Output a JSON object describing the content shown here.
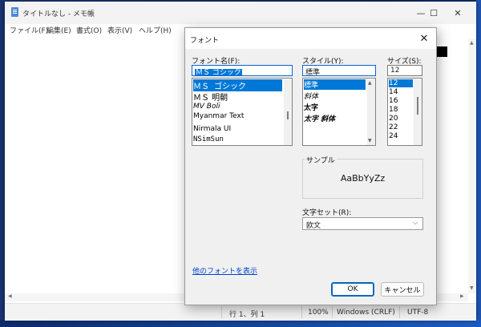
{
  "window": {
    "title": "タイトルなし - メモ帳",
    "minimize_glyph": "—",
    "maximize_glyph": "☐",
    "close_glyph": "✕"
  },
  "menu": [
    "ファイル(F)",
    "編集(E)",
    "書式(O)",
    "表示(V)",
    "ヘルプ(H)"
  ],
  "statusbar": {
    "position": "行 1、列 1",
    "zoom": "100%",
    "line_ending": "Windows (CRLF)",
    "encoding": "UTF-8"
  },
  "dialog": {
    "title": "フォント",
    "close_glyph": "✕",
    "font_name": {
      "label": "フォント名(F):",
      "value": "ＭＳ ゴシック",
      "items": [
        "ＭＳ ゴシック",
        "ＭＳ 明朝",
        "MV Boli",
        "Myanmar Text",
        "Nirmala UI",
        "NSimSun"
      ],
      "selected_index": 0
    },
    "style": {
      "label": "スタイル(Y):",
      "value": "標準",
      "items": [
        "標準",
        "斜体",
        "太字",
        "太字 斜体"
      ],
      "selected_index": 0
    },
    "size": {
      "label": "サイズ(S):",
      "value": "12",
      "items": [
        "12",
        "14",
        "16",
        "18",
        "20",
        "22",
        "24"
      ],
      "selected_index": 0
    },
    "sample": {
      "label": "サンプル",
      "text": "AaBbYyZz"
    },
    "charset": {
      "label": "文字セット(R):",
      "value": "欧文"
    },
    "more_fonts_link": "他のフォントを表示",
    "ok_label": "OK",
    "cancel_label": "キャンセル"
  },
  "colors": {
    "selection": "#0078d7",
    "link": "#0044cc",
    "desktop": "#1d3a7a"
  }
}
